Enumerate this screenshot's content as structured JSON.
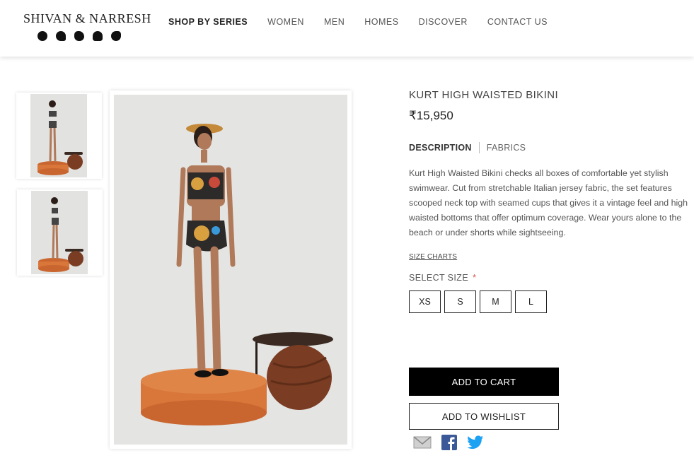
{
  "header": {
    "brand": "SHIVAN & NARRESH",
    "nav": [
      "SHOP BY SERIES",
      "WOMEN",
      "MEN",
      "HOMES",
      "DISCOVER",
      "CONTACT US"
    ]
  },
  "product": {
    "title": "KURT HIGH WAISTED BIKINI",
    "price": "₹15,950",
    "tabs": {
      "description": "DESCRIPTION",
      "fabrics": "FABRICS"
    },
    "description": "Kurt High Waisted Bikini checks all boxes of comfortable yet stylish swimwear. Cut from stretchable Italian jersey fabric, the set features scooped neck top with seamed cups that gives it a vintage feel and high waisted bottoms that offer optimum coverage. Wear yours alone to the beach or under shorts while sightseeing.",
    "size_chart_link": "SIZE CHARTS",
    "select_size_label": "SELECT SIZE",
    "required_marker": "*",
    "sizes": [
      "XS",
      "S",
      "M",
      "L"
    ],
    "add_to_cart": "ADD TO CART",
    "add_to_wishlist": "ADD TO WISHLIST"
  },
  "share_icons": [
    "email-icon",
    "facebook-icon",
    "twitter-icon"
  ],
  "colors": {
    "cart_button_bg": "#000000",
    "required_asterisk": "#d9534f",
    "facebook": "#3b5998",
    "twitter": "#1da1f2",
    "pedestal": "#d9763a",
    "wood": "#7a3c22"
  }
}
